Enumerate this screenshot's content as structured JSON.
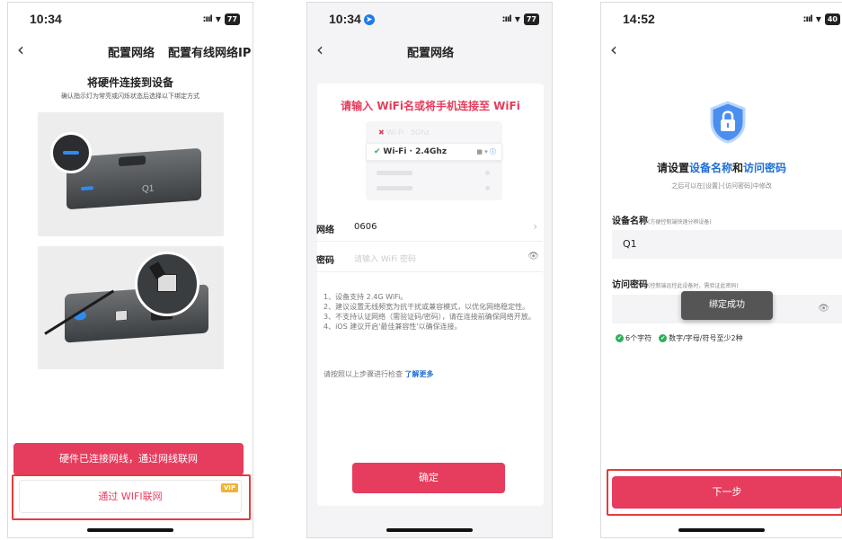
{
  "phone1": {
    "status": {
      "time": "10:34",
      "battery": "77"
    },
    "nav": {
      "title": "配置网络",
      "right_link": "配置有线网络IP"
    },
    "title": "将硬件连接到设备",
    "subtitle": "确认指示灯为常亮或闪烁状态后选择以下绑定方式",
    "device_label": "Q1",
    "btn_wired": "硬件已连接网线，通过网线联网",
    "btn_wifi": "通过 WIFI联网",
    "vip_badge": "VIP"
  },
  "phone2": {
    "status": {
      "time": "10:34",
      "battery": "77"
    },
    "nav": {
      "title": "配置网络"
    },
    "header": "请输入 WiFi名或将手机连接至 WiFi",
    "wifi_5g": "Wi-Fi · 5Ghz",
    "wifi_24g": "Wi-Fi · 2.4Ghz",
    "network_label": "网络",
    "network_value": "0606",
    "password_label": "密码",
    "password_placeholder": "请输入 WiFi 密码",
    "tips": [
      "1、设备支持 2.4G WiFi。",
      "2、建议设置无线频宽为抗干扰或兼容模式，以优化网络稳定性。",
      "3、不支持认证网络（需验证码/密码），请在连接前确保网络开放。",
      "4、iOS 建议开启'最佳兼容性'以确保连接。"
    ],
    "check_text": "请按照以上步骤进行检查",
    "learn_more": "了解更多",
    "confirm_btn": "确定"
  },
  "phone3": {
    "status": {
      "time": "14:52",
      "battery": "40"
    },
    "title_pre": "请设置",
    "title_acc1": "设备名称",
    "title_mid": "和",
    "title_acc2": "访问密码",
    "subtitle": "之后可以在[设置]-[访问密码]中修改",
    "name_label": "设备名称",
    "name_hint": "(方便控制端快速分辨设备)",
    "name_value": "Q1",
    "pwd_label": "访问密码",
    "pwd_hint": "(控制端远控此设备时，需验证此密码)",
    "toast": "绑定成功",
    "rule1": "6个字符",
    "rule2": "数字/字母/符号至少2种",
    "next_btn": "下一步"
  },
  "colors": {
    "accent": "#e63c5d",
    "link": "#1f6fd6",
    "highlight": "#e53b3b",
    "success": "#2eaf5b"
  }
}
